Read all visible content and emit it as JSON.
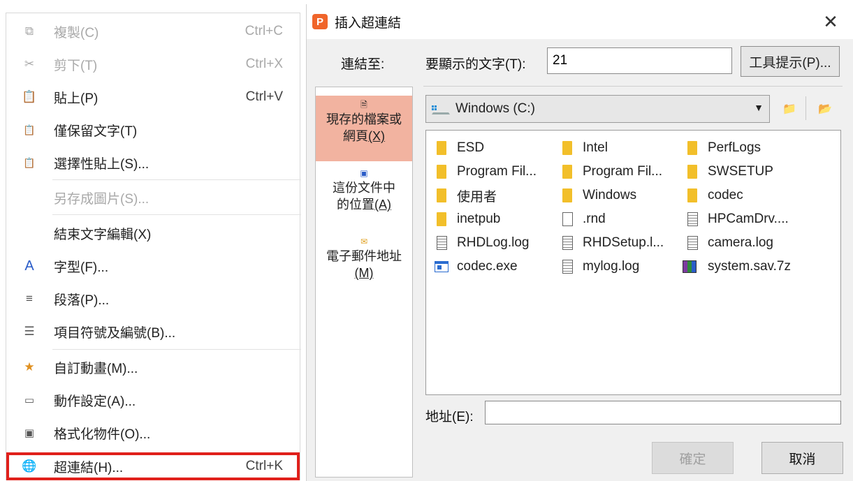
{
  "menu": {
    "items": [
      {
        "label": "複製(C)",
        "shortcut": "Ctrl+C",
        "icon": "copy-icon",
        "disabled": true
      },
      {
        "label": "剪下(T)",
        "shortcut": "Ctrl+X",
        "icon": "scissors-icon",
        "disabled": true
      },
      {
        "label": "貼上(P)",
        "shortcut": "Ctrl+V",
        "icon": "paste-icon",
        "disabled": false
      },
      {
        "label": "僅保留文字(T)",
        "shortcut": "",
        "icon": "paste-text-icon",
        "disabled": false
      },
      {
        "label": "選擇性貼上(S)...",
        "shortcut": "",
        "icon": "paste-special-icon",
        "disabled": false
      },
      {
        "label": "另存成圖片(S)...",
        "shortcut": "",
        "icon": "",
        "disabled": true
      },
      {
        "label": "結束文字編輯(X)",
        "shortcut": "",
        "icon": "",
        "disabled": false
      },
      {
        "label": "字型(F)...",
        "shortcut": "",
        "icon": "font-icon",
        "disabled": false
      },
      {
        "label": "段落(P)...",
        "shortcut": "",
        "icon": "paragraph-icon",
        "disabled": false
      },
      {
        "label": "項目符號及編號(B)...",
        "shortcut": "",
        "icon": "bullets-icon",
        "disabled": false
      },
      {
        "label": "自訂動畫(M)...",
        "shortcut": "",
        "icon": "animation-icon",
        "disabled": false
      },
      {
        "label": "動作設定(A)...",
        "shortcut": "",
        "icon": "action-icon",
        "disabled": false
      },
      {
        "label": "格式化物件(O)...",
        "shortcut": "",
        "icon": "format-object-icon",
        "disabled": false
      },
      {
        "label": "超連結(H)...",
        "shortcut": "Ctrl+K",
        "icon": "hyperlink-icon",
        "disabled": false,
        "highlighted": true
      }
    ]
  },
  "dialog": {
    "title": "插入超連結",
    "link_to_label": "連結至:",
    "display_text_label": "要顯示的文字(T):",
    "display_text_value": "21",
    "tooltip_button": "工具提示(P)...",
    "nav": [
      {
        "line1": "現存的檔案或",
        "line2": "網頁",
        "key": "(X)",
        "selected": true
      },
      {
        "line1": "這份文件中",
        "line2": "的位置",
        "key": "(A)",
        "selected": false
      },
      {
        "line1": "電子郵件地址",
        "line2": "",
        "key": "(M)",
        "selected": false
      }
    ],
    "drive": "Windows (C:)",
    "files": [
      {
        "name": "ESD",
        "type": "folder"
      },
      {
        "name": "Intel",
        "type": "folder"
      },
      {
        "name": "PerfLogs",
        "type": "folder"
      },
      {
        "name": "Program Fil...",
        "type": "folder"
      },
      {
        "name": "Program Fil...",
        "type": "folder"
      },
      {
        "name": "SWSETUP",
        "type": "folder"
      },
      {
        "name": "使用者",
        "type": "folder"
      },
      {
        "name": "Windows",
        "type": "folder"
      },
      {
        "name": "codec",
        "type": "folder"
      },
      {
        "name": "inetpub",
        "type": "folder"
      },
      {
        "name": ".rnd",
        "type": "doc"
      },
      {
        "name": "HPCamDrv....",
        "type": "lines"
      },
      {
        "name": "RHDLog.log",
        "type": "lines"
      },
      {
        "name": "RHDSetup.l...",
        "type": "lines"
      },
      {
        "name": "camera.log",
        "type": "lines"
      },
      {
        "name": "codec.exe",
        "type": "exe"
      },
      {
        "name": "mylog.log",
        "type": "lines"
      },
      {
        "name": "system.sav.7z",
        "type": "rar"
      }
    ],
    "address_label": "地址(E):",
    "address_value": "",
    "ok_button": "確定",
    "cancel_button": "取消"
  }
}
